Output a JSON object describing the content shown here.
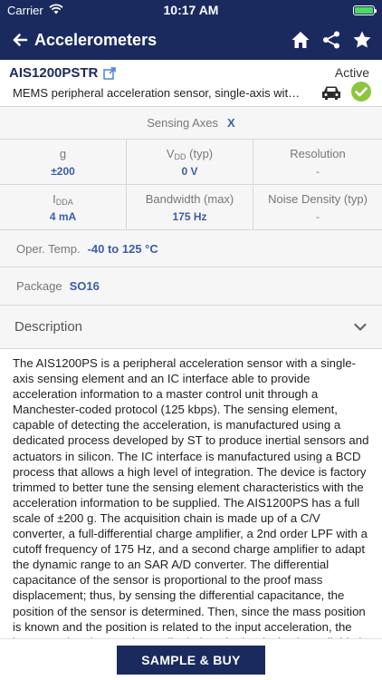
{
  "status_bar": {
    "carrier": "Carrier",
    "time": "10:17 AM",
    "battery_level": 1.0
  },
  "navbar": {
    "title": "Accelerometers",
    "actions": [
      "home-icon",
      "share-icon",
      "star-icon"
    ]
  },
  "product": {
    "part_number": "AIS1200PSTR",
    "status": "Active",
    "description": "MEMS peripheral acceleration sensor, single-axis wit…"
  },
  "specs": {
    "sensing_axes": {
      "label": "Sensing Axes",
      "value": "X"
    },
    "g": {
      "label": "g",
      "value": "±200"
    },
    "vdd": {
      "label_main": "V",
      "label_sub": "DD",
      "label_suffix": " (typ)",
      "value": "0 V"
    },
    "resolution": {
      "label": "Resolution",
      "value": "-"
    },
    "idda": {
      "label_main": "I",
      "label_sub": "DDA",
      "value": "4 mA"
    },
    "bandwidth": {
      "label": "Bandwidth (max)",
      "value": "175 Hz"
    },
    "noise_density": {
      "label": "Noise Density (typ)",
      "value": "-"
    },
    "oper_temp": {
      "label": "Oper. Temp.",
      "value": "-40 to 125 °C"
    },
    "package": {
      "label": "Package",
      "value": "SO16"
    }
  },
  "description_section": {
    "title": "Description",
    "body": "The AIS1200PS is a peripheral acceleration sensor with a single-axis sensing element and an IC interface able to provide acceleration information to a master control unit through a Manchester-coded protocol (125 kbps). The sensing element, capable of detecting the acceleration, is manufactured using a dedicated process developed by ST to produce inertial sensors and actuators in silicon. The IC interface is manufactured using a BCD process that allows a high level of integration. The device is factory trimmed to better tune the sensing element characteristics with the acceleration information to be supplied. The AIS1200PS has a full scale of ±200 g. The acquisition chain is made up of a C/V converter, a full-differential charge amplifier, a 2nd order LPF with a cutoff frequency of 175 Hz, and a second charge amplifier to adapt the dynamic range to an SAR A/D converter. The differential capacitance of the sensor is proportional to the proof mass displacement; thus, by sensing the differential capacitance, the position of the sensor is determined. Then, since the mass position is known and the position is related to the input acceleration, the input acceleration can be easily deduced. The device is available in"
  },
  "footer": {
    "button_label": "SAMPLE & BUY"
  },
  "colors": {
    "brand_navy": "#1b2a5e",
    "value_blue": "#3b5ea8",
    "active_green": "#8cc63f"
  }
}
